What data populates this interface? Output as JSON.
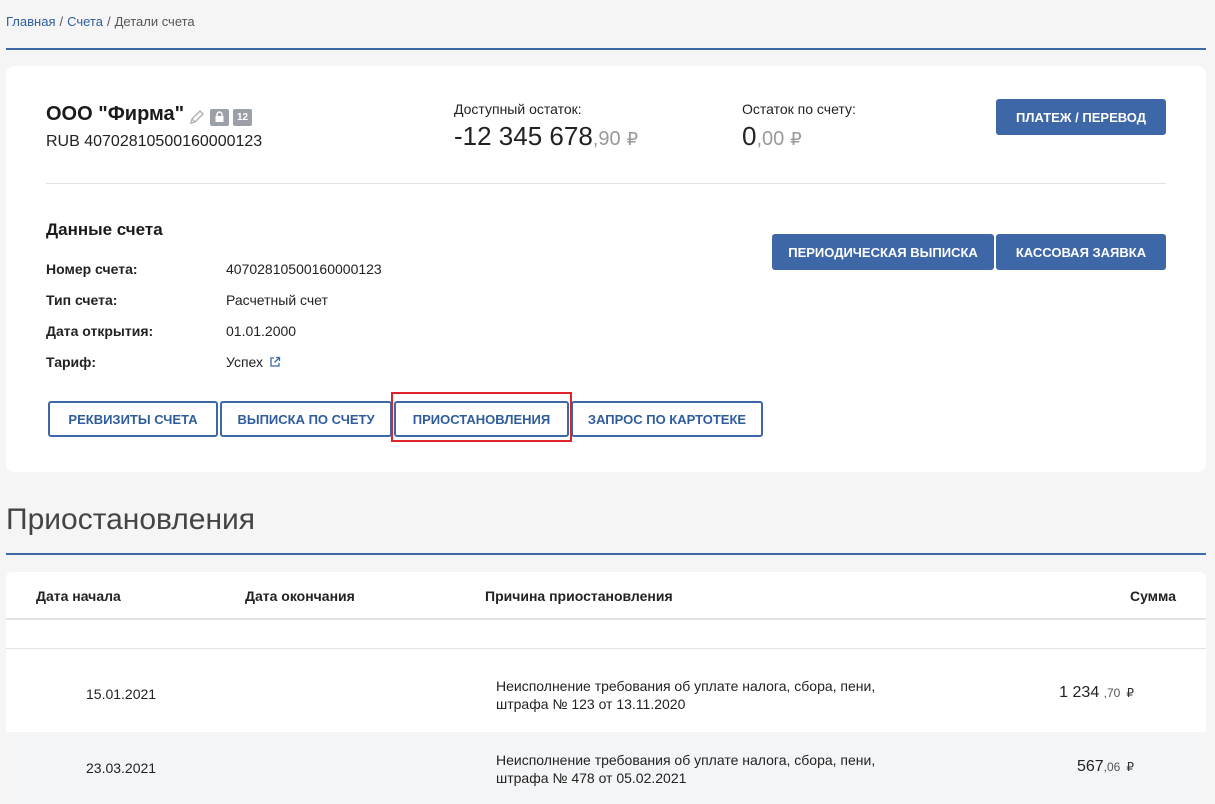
{
  "breadcrumb": {
    "home": "Главная",
    "accounts": "Счета",
    "current": "Детали счета",
    "separator": "/"
  },
  "account": {
    "company_name": "ООО \"Фирма\"",
    "badge_number": "12",
    "currency_account": "RUB 40702810500160000123",
    "available_label": "Доступный остаток:",
    "available_int": "-12 345 678",
    "available_frac": ",90",
    "balance_label": "Остаток по счету:",
    "balance_int": "0",
    "balance_frac": ",00",
    "currency_symbol": "₽",
    "payment_button": "ПЛАТЕЖ / ПЕРЕВОД"
  },
  "details": {
    "title": "Данные счета",
    "rows": [
      {
        "label": "Номер счета:",
        "value": "40702810500160000123"
      },
      {
        "label": "Тип счета:",
        "value": "Расчетный счет"
      },
      {
        "label": "Дата открытия:",
        "value": "01.01.2000"
      },
      {
        "label": "Тариф:",
        "value": "Успех"
      }
    ],
    "periodic_button": "ПЕРИОДИЧЕСКАЯ ВЫПИСКА",
    "cash_button": "КАССОВАЯ ЗАЯВКА"
  },
  "tabs": [
    "РЕКВИЗИТЫ СЧЕТА",
    "ВЫПИСКА ПО СЧЕТУ",
    "ПРИОСТАНОВЛЕНИЯ",
    "ЗАПРОС ПО КАРТОТЕКЕ"
  ],
  "suspensions": {
    "heading": "Приостановления",
    "columns": [
      "Дата начала",
      "Дата окончания",
      "Причина приостановления",
      "Сумма"
    ],
    "rows": [
      {
        "start": "15.01.2021",
        "end": "",
        "reason": "Неисполнение требования об уплате налога, сбора, пени, штрафа № 123 от 13.11.2020",
        "amount_int": "1 234",
        "amount_frac": ",70",
        "currency": "₽"
      },
      {
        "start": "23.03.2021",
        "end": "",
        "reason": "Неисполнение требования об уплате налога, сбора, пени, штрафа № 478 от 05.02.2021",
        "amount_int": "567",
        "amount_frac": ",06",
        "currency": "₽"
      }
    ]
  },
  "colors": {
    "primary": "#3e67a8",
    "highlight": "#e0232b",
    "muted": "#999999"
  }
}
